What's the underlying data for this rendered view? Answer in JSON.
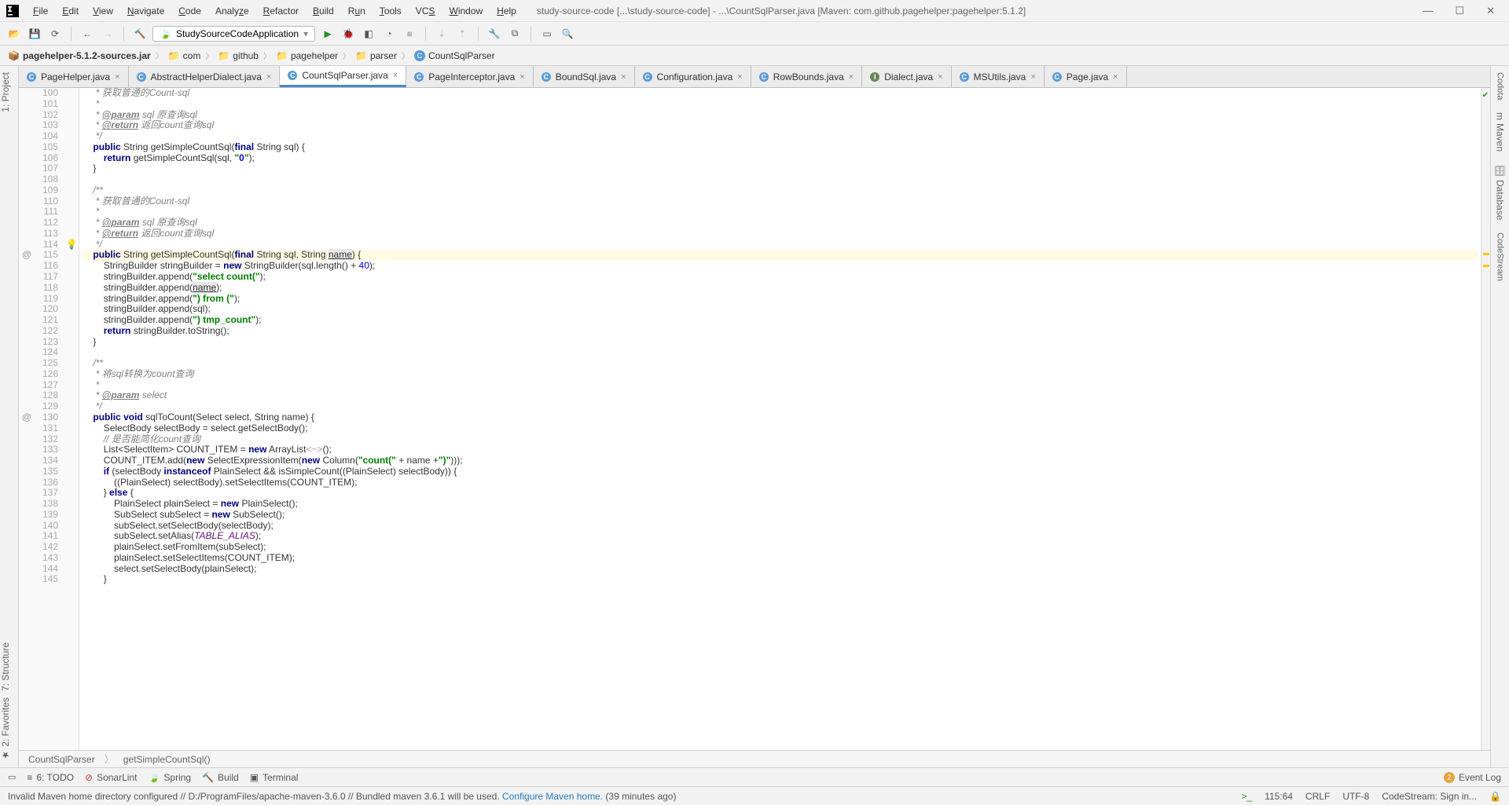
{
  "menu": {
    "items": [
      "File",
      "Edit",
      "View",
      "Navigate",
      "Code",
      "Analyze",
      "Refactor",
      "Build",
      "Run",
      "Tools",
      "VCS",
      "Window",
      "Help"
    ],
    "title": "study-source-code [...\\study-source-code] - ...\\CountSqlParser.java [Maven: com.github.pagehelper:pagehelper:5.1.2]"
  },
  "runConfig": "StudySourceCodeApplication",
  "breadcrumb": {
    "root": "pagehelper-5.1.2-sources.jar",
    "items": [
      "com",
      "github",
      "pagehelper",
      "parser",
      "CountSqlParser"
    ]
  },
  "tabs": [
    {
      "label": "PageHelper.java",
      "icon": "C"
    },
    {
      "label": "AbstractHelperDialect.java",
      "icon": "C"
    },
    {
      "label": "CountSqlParser.java",
      "icon": "C",
      "active": true
    },
    {
      "label": "PageInterceptor.java",
      "icon": "C"
    },
    {
      "label": "BoundSql.java",
      "icon": "C"
    },
    {
      "label": "Configuration.java",
      "icon": "C"
    },
    {
      "label": "RowBounds.java",
      "icon": "C"
    },
    {
      "label": "Dialect.java",
      "icon": "I"
    },
    {
      "label": "MSUtils.java",
      "icon": "C"
    },
    {
      "label": "Page.java",
      "icon": "C"
    }
  ],
  "leftTools": {
    "top": [
      "1: Project"
    ],
    "bottom": [
      "7: Structure",
      "2: Favorites"
    ]
  },
  "rightTools": [
    "Codota",
    "Maven",
    "Database",
    "CodeStream"
  ],
  "lineStart": 100,
  "lineEnd": 145,
  "marks": {
    "115": "@",
    "130": "@"
  },
  "hints": {
    "114": "💡"
  },
  "highlightLine": 115,
  "code": [
    "     * 获取普通的Count-sql",
    "     *",
    "     * @param sql 原查询sql",
    "     * @return 返回count查询sql",
    "     */",
    "    public String getSimpleCountSql(final String sql) {",
    "        return getSimpleCountSql(sql, \"0\");",
    "    }",
    "",
    "    /**",
    "     * 获取普通的Count-sql",
    "     *",
    "     * @param sql 原查询sql",
    "     * @return 返回count查询sql",
    "     */",
    "    public String getSimpleCountSql(final String sql, String name) {",
    "        StringBuilder stringBuilder = new StringBuilder(sql.length() + 40);",
    "        stringBuilder.append(\"select count(\");",
    "        stringBuilder.append(name);",
    "        stringBuilder.append(\") from (\");",
    "        stringBuilder.append(sql);",
    "        stringBuilder.append(\") tmp_count\");",
    "        return stringBuilder.toString();",
    "    }",
    "",
    "    /**",
    "     * 将sql转换为count查询",
    "     *",
    "     * @param select",
    "     */",
    "    public void sqlToCount(Select select, String name) {",
    "        SelectBody selectBody = select.getSelectBody();",
    "        // 是否能简化count查询",
    "        List<SelectItem> COUNT_ITEM = new ArrayList<~>();",
    "        COUNT_ITEM.add(new SelectExpressionItem(new Column(\"count(\" + name +\")\")));",
    "        if (selectBody instanceof PlainSelect && isSimpleCount((PlainSelect) selectBody)) {",
    "            ((PlainSelect) selectBody).setSelectItems(COUNT_ITEM);",
    "        } else {",
    "            PlainSelect plainSelect = new PlainSelect();",
    "            SubSelect subSelect = new SubSelect();",
    "            subSelect.setSelectBody(selectBody);",
    "            subSelect.setAlias(TABLE_ALIAS);",
    "            plainSelect.setFromItem(subSelect);",
    "            plainSelect.setSelectItems(COUNT_ITEM);",
    "            select.setSelectBody(plainSelect);",
    "        }"
  ],
  "crumbBar": {
    "class": "CountSqlParser",
    "method": "getSimpleCountSql()"
  },
  "bottomBar": {
    "items": [
      "6: TODO",
      "SonarLint",
      "Spring",
      "Build",
      "Terminal"
    ],
    "eventLog": "Event Log",
    "eventCount": "2"
  },
  "statusBar": {
    "msg_pre": "Invalid Maven home directory configured // D:/ProgramFiles/apache-maven-3.6.0 // Bundled maven 3.6.1 will be used.  ",
    "msg_link": "Configure Maven home.",
    "msg_time": "  (39 minutes ago)",
    "pos": "115:64",
    "eol": "CRLF",
    "enc": "UTF-8",
    "cs": "CodeStream: Sign in..."
  }
}
